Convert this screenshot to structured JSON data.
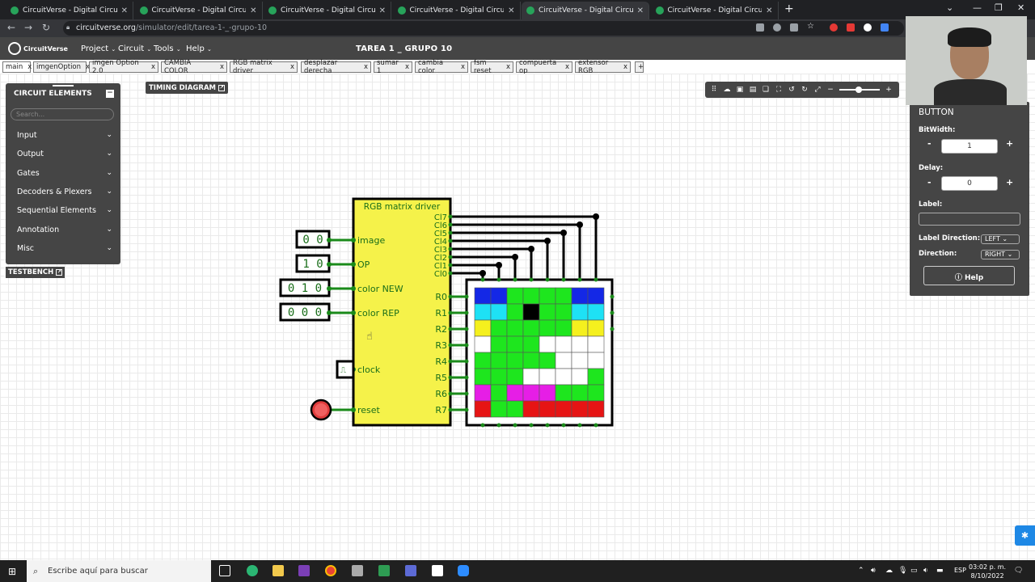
{
  "browser": {
    "tabs": [
      {
        "title": "CircuitVerse - Digital Circuit Simu",
        "active": false
      },
      {
        "title": "CircuitVerse - Digital Circuit Simu",
        "active": false
      },
      {
        "title": "CircuitVerse - Digital Circuit Simu",
        "active": false
      },
      {
        "title": "CircuitVerse - Digital Circuit Simu",
        "active": false
      },
      {
        "title": "CircuitVerse - Digital Circuit Simu",
        "active": true
      },
      {
        "title": "CircuitVerse - Digital Circuit Simu",
        "active": false
      }
    ],
    "url_host": "circuitverse.org",
    "url_path": "/simulator/edit/tarea-1-_-grupo-10",
    "new_tab": "+"
  },
  "app": {
    "logo_text": "CircuitVerse",
    "menus": [
      "Project",
      "Circuit",
      "Tools",
      "Help"
    ],
    "project_title": "TAREA 1 _ GRUPO 10"
  },
  "circuit_tabs": [
    "main",
    "imgenOption",
    "imgen Option 2.0",
    "CAMBIA COLOR",
    "RGB matrix driver",
    "desplazar derecha",
    "sumar 1",
    "cambia color",
    "fsm reset",
    "compuerta op",
    "extensor RGB"
  ],
  "elements_panel": {
    "header": "CIRCUIT ELEMENTS",
    "search_placeholder": "Search...",
    "categories": [
      "Input",
      "Output",
      "Gates",
      "Decoders & Plexers",
      "Sequential Elements",
      "Annotation",
      "Misc"
    ]
  },
  "timing_label": "TIMING DIAGRAM",
  "testbench_label": "TESTBENCH",
  "properties": {
    "title": "BUTTON",
    "bitwidth_label": "BitWidth:",
    "bitwidth_value": "1",
    "delay_label": "Delay:",
    "delay_value": "0",
    "label_label": "Label:",
    "label_value": "",
    "label_direction_label": "Label Direction:",
    "label_direction_value": "LEFT",
    "direction_label": "Direction:",
    "direction_value": "RIGHT",
    "minus": "-",
    "plus": "+",
    "help_label": "Help"
  },
  "circuit": {
    "block_title": "RGB matrix driver",
    "input_ports": [
      "image",
      "OP",
      "color NEW",
      "color REP",
      "clock",
      "reset"
    ],
    "column_ports": [
      "Cl7",
      "Cl6",
      "Cl5",
      "Cl4",
      "Cl3",
      "Cl2",
      "Cl1",
      "Cl0"
    ],
    "row_ports": [
      "R0",
      "R1",
      "R2",
      "R3",
      "R4",
      "R5",
      "R6",
      "R7"
    ],
    "inputs": [
      {
        "name": "image",
        "value": "0 0"
      },
      {
        "name": "OP",
        "value": "1 0"
      },
      {
        "name": "color NEW",
        "value": "0 1 0"
      },
      {
        "name": "color REP",
        "value": "0 0 0"
      }
    ],
    "matrix_colors": {
      "B": "#1428e6",
      "C": "#1ee1f5",
      "G": "#1ee61e",
      "K": "#000000",
      "Y": "#f5f01e",
      "W": "#ffffff",
      "M": "#e61ee6",
      "R": "#e61414"
    },
    "matrix": [
      "BBGGGGBB",
      "CCGKGGCC",
      "YGGGGGYY",
      "WGGGWWWW",
      "GGGGGWWW",
      "GGGWWWWG",
      "MGMMMGGG",
      "RGGRRRRR"
    ]
  },
  "taskbar": {
    "search_placeholder": "Escribe aquí para buscar",
    "lang": "ESP",
    "time": "03:02 p. m.",
    "date": "8/10/2022"
  }
}
